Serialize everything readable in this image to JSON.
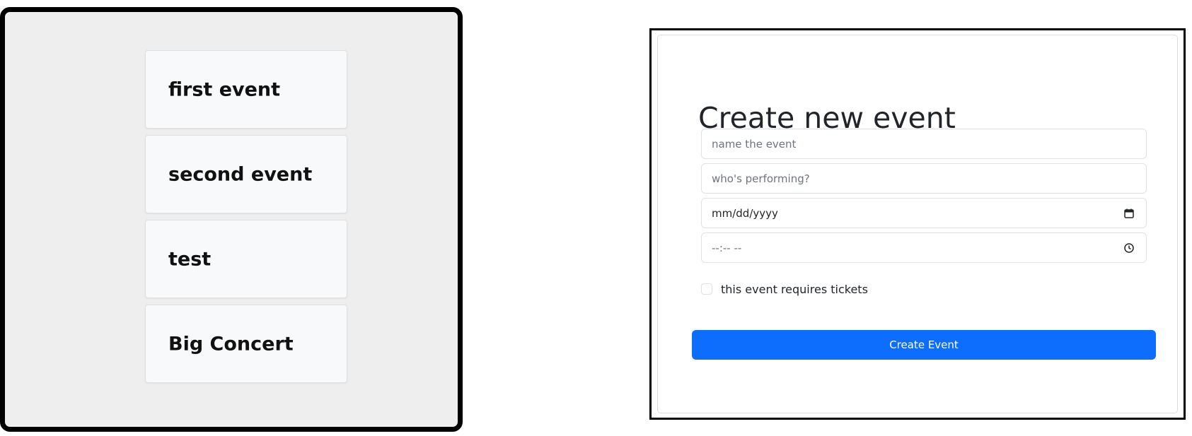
{
  "event_list": {
    "items": [
      {
        "title": "first event"
      },
      {
        "title": "second event"
      },
      {
        "title": "test"
      },
      {
        "title": "Big Concert"
      }
    ]
  },
  "create_form": {
    "title": "Create new event",
    "name_field": {
      "placeholder": "name the event",
      "value": ""
    },
    "performer_field": {
      "placeholder": "who's performing?",
      "value": ""
    },
    "date_field": {
      "display": "mm/dd/yyyy",
      "icon": "calendar-icon"
    },
    "time_field": {
      "display": "--:-- --",
      "icon": "clock-icon"
    },
    "tickets_checkbox": {
      "label": "this event requires tickets",
      "checked": false
    },
    "submit_label": "Create Event"
  },
  "colors": {
    "accent": "#0d6efd",
    "panel_background": "#eeeeee",
    "card_background": "#f8f9fa"
  }
}
